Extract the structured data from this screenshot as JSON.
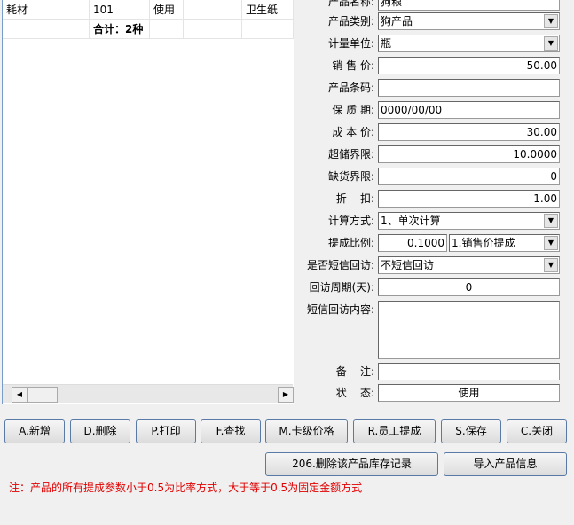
{
  "grid": {
    "row": [
      "耗材",
      "101",
      "使用",
      "",
      "卫生纸"
    ],
    "total": "合计：2种"
  },
  "form": {
    "name_label": "产品名称:",
    "name": "狗粮",
    "category_label": "产品类别:",
    "category": "狗产品",
    "unit_label": "计量单位:",
    "unit": "瓶",
    "price_label": "销 售 价:",
    "price": "50.00",
    "barcode_label": "产品条码:",
    "barcode": "",
    "shelf_label": "保 质 期:",
    "shelf": "0000/00/00",
    "cost_label": "成 本 价:",
    "cost": "30.00",
    "over_label": "超储界限:",
    "over": "10.0000",
    "short_label": "缺货界限:",
    "short": "0",
    "discount_label": "折    扣:",
    "discount": "1.00",
    "calc_label": "计算方式:",
    "calc": "1、单次计算",
    "commission_label": "提成比例:",
    "commission": "0.1000",
    "commission_type": "1.销售价提成",
    "sms_label": "是否短信回访:",
    "sms": "不短信回访",
    "period_label": "回访周期(天):",
    "period": "0",
    "sms_content_label": "短信回访内容:",
    "sms_content": "",
    "remark_label": "备    注:",
    "remark": "",
    "status_label": "状    态:",
    "status": "使用"
  },
  "buttons": [
    "A.新增",
    "D.删除",
    "P.打印",
    "F.查找",
    "M.卡级价格",
    "R.员工提成",
    "S.保存",
    "C.关闭"
  ],
  "buttons2": [
    "206.删除该产品库存记录",
    "导入产品信息"
  ],
  "note": "注：产品的所有提成参数小于0.5为比率方式，大于等于0.5为固定金额方式"
}
